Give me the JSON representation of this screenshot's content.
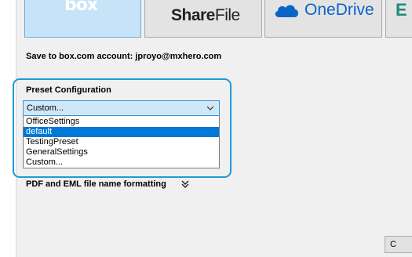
{
  "tiles": {
    "box_logo": "box",
    "sharefile_logo": "ShareFile",
    "sharefile_logo_bold": "Share",
    "sharefile_logo_regular": "File",
    "onedrive_logo": "OneDrive",
    "egnyte_logo": "E"
  },
  "account": {
    "label": "Save to box.com account: jproyo@mxhero.com"
  },
  "preset": {
    "label": "Preset Configuration",
    "selected_value": "Custom...",
    "options": [
      "OfficeSettings",
      "default",
      "TestingPreset",
      "GeneralSettings",
      "Custom..."
    ],
    "highlighted_option": "default"
  },
  "formatting": {
    "label": "PDF and EML file name formatting"
  },
  "footer": {
    "ok_button_label": "C"
  },
  "colors": {
    "selected_tile": "#c7e3f8",
    "highlight_border": "#1e9bd8",
    "selection_blue": "#0078d7",
    "onedrive_blue": "#0a64c8"
  },
  "icons": {
    "dropdown": "chevron-down-icon",
    "expand": "double-chevron-down-icon",
    "onedrive": "cloud-icon"
  }
}
